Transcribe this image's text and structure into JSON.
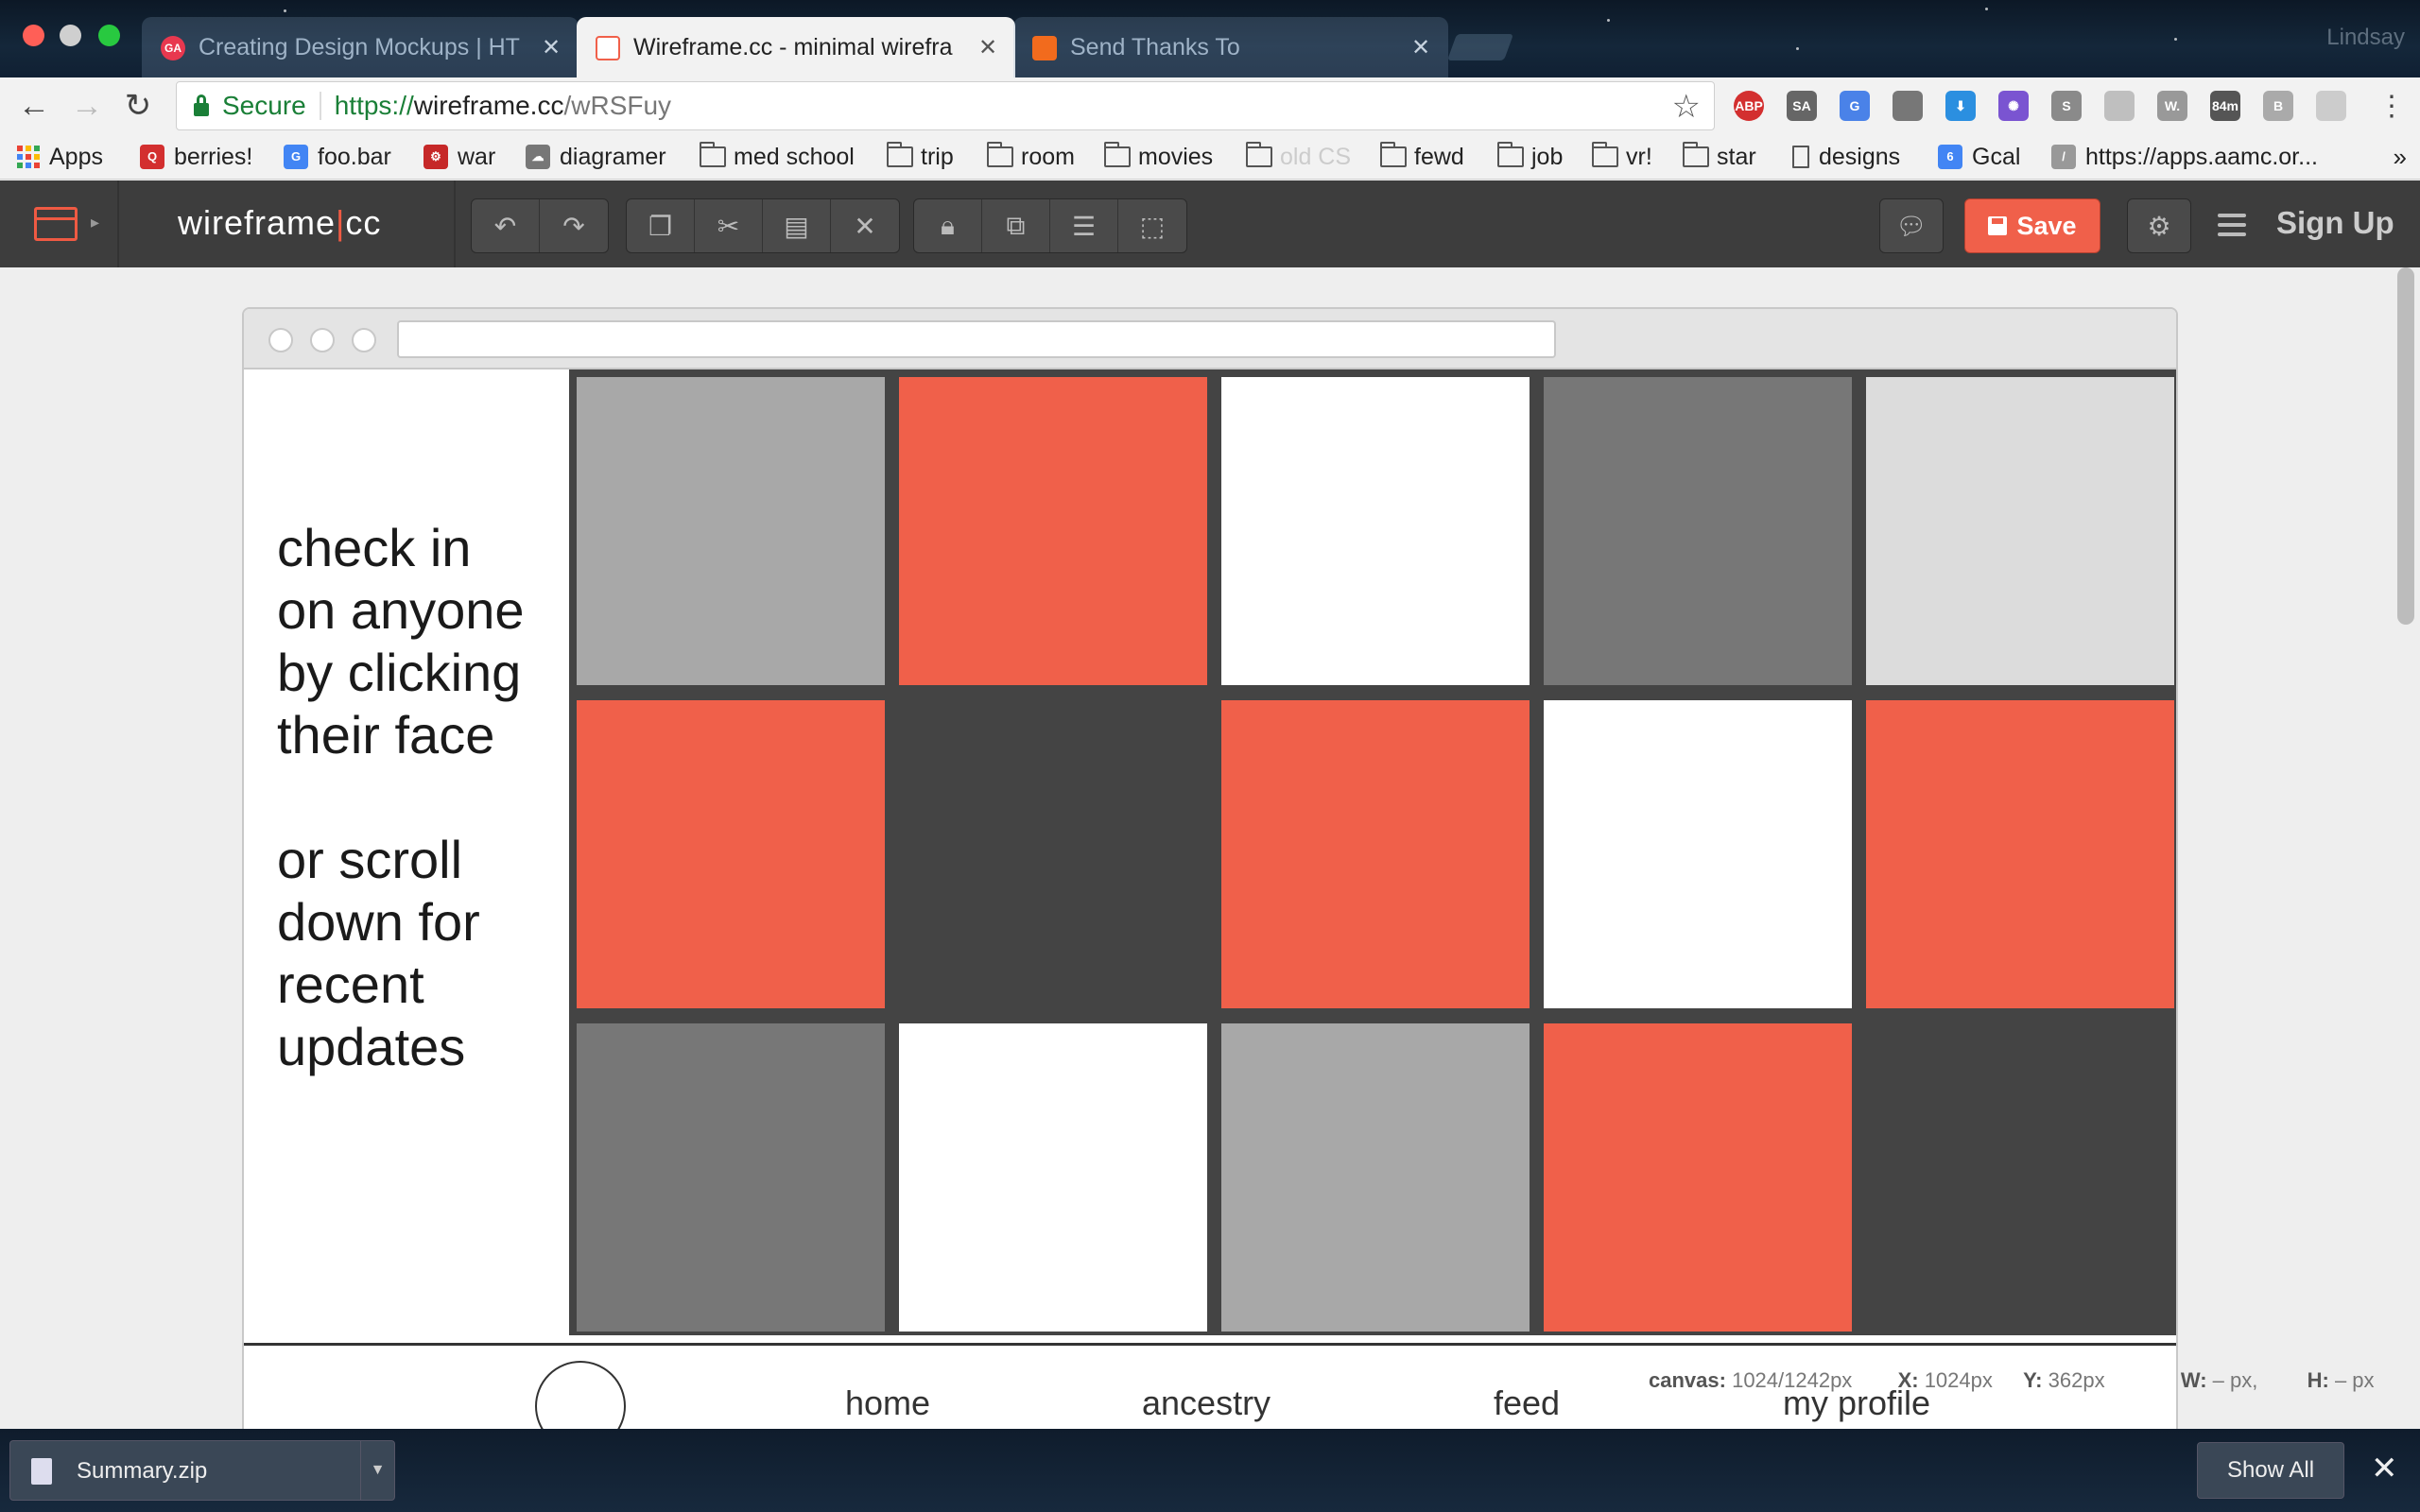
{
  "browser": {
    "tabs": [
      {
        "title": "Creating Design Mockups | HT",
        "favicon": "GA",
        "favicon_color": "#e8384f",
        "active": false
      },
      {
        "title": "Wireframe.cc - minimal wirefra",
        "favicon": "",
        "favicon_color": "#f0604a",
        "active": true
      },
      {
        "title": "Send Thanks To",
        "favicon": "",
        "favicon_color": "#f26b1d",
        "active": false
      }
    ],
    "profile_name": "Lindsay",
    "address": {
      "secure_label": "Secure",
      "url_scheme": "https://",
      "url_host": "wireframe.cc",
      "url_path": "/wRSFuy"
    },
    "extensions": [
      {
        "label": "ABP",
        "color": "#d32f2f",
        "name": "adblock-plus-icon"
      },
      {
        "label": "SA",
        "color": "#666666",
        "name": "sa-extension-icon"
      },
      {
        "label": "G",
        "color": "#4a82e8",
        "name": "google-translate-icon"
      },
      {
        "label": "",
        "color": "#777777",
        "name": "settings-extension-icon"
      },
      {
        "label": "⬇",
        "color": "#2b8fe0",
        "name": "download-extension-icon"
      },
      {
        "label": "✺",
        "color": "#7a54d1",
        "name": "dots-extension-icon"
      },
      {
        "label": "S",
        "color": "#8a8a8a",
        "name": "skype-icon"
      },
      {
        "label": "",
        "color": "#bfbfbf",
        "name": "blank-extension-icon"
      },
      {
        "label": "W.",
        "color": "#999999",
        "name": "w-extension-icon"
      },
      {
        "label": "84m",
        "color": "#555555",
        "name": "timer-extension-icon"
      },
      {
        "label": "B",
        "color": "#aaaaaa",
        "name": "b-extension-icon"
      },
      {
        "label": "",
        "color": "#cccccc",
        "name": "profile-extension-icon"
      }
    ],
    "bookmarks": [
      {
        "label": "Apps",
        "kind": "apps"
      },
      {
        "label": "berries!",
        "kind": "icon",
        "color": "#d32f2f",
        "glyph": "Q"
      },
      {
        "label": "foo.bar",
        "kind": "icon",
        "color": "#4285f4",
        "glyph": "G"
      },
      {
        "label": "war",
        "kind": "icon",
        "color": "#c62828",
        "glyph": "⚙"
      },
      {
        "label": "diagramer",
        "kind": "icon",
        "color": "#777777",
        "glyph": "☁"
      },
      {
        "label": "med school",
        "kind": "folder"
      },
      {
        "label": "trip",
        "kind": "folder"
      },
      {
        "label": "room",
        "kind": "folder"
      },
      {
        "label": "movies",
        "kind": "folder"
      },
      {
        "label": "old CS",
        "kind": "folder"
      },
      {
        "label": "fewd",
        "kind": "folder"
      },
      {
        "label": "job",
        "kind": "folder"
      },
      {
        "label": "vr!",
        "kind": "folder"
      },
      {
        "label": "star",
        "kind": "folder"
      },
      {
        "label": "designs",
        "kind": "doc"
      },
      {
        "label": "Gcal",
        "kind": "icon",
        "color": "#4285f4",
        "glyph": "6"
      },
      {
        "label": "https://apps.aamc.or...",
        "kind": "icon",
        "color": "#999999",
        "glyph": "/"
      }
    ],
    "more_bookmarks": "»"
  },
  "app": {
    "brand_left": "wireframe",
    "brand_sep": "|",
    "brand_right": "cc",
    "save_label": "Save",
    "signup_label": "Sign Up"
  },
  "canvas": {
    "side_text_lines": [
      "check in",
      "on anyone",
      "by clicking",
      "their face"
    ],
    "side_text_lines2": [
      "or scroll",
      "down for",
      "recent",
      "updates"
    ],
    "grid_colors": [
      [
        "#a8a8a8",
        "#f0604a",
        "#ffffff",
        "#777777",
        "#dcdcdc"
      ],
      [
        "#f0604a",
        null,
        "#f0604a",
        "#ffffff",
        "#f0604a"
      ],
      [
        "#777777",
        "#ffffff",
        "#a8a8a8",
        "#f0604a",
        null
      ]
    ],
    "nav": {
      "home": "home",
      "ancestry": "ancestry",
      "feed": "feed",
      "profile": "my profile"
    },
    "status": {
      "canvas_label": "canvas:",
      "canvas_value": "1024/1242px",
      "x_label": "X:",
      "x_value": "1024px",
      "y_label": "Y:",
      "y_value": "362px",
      "w_label": "W:",
      "w_value": "– px,",
      "h_label": "H:",
      "h_value": "– px"
    }
  },
  "downloads": {
    "file_name": "Summary.zip",
    "show_all_label": "Show All"
  }
}
